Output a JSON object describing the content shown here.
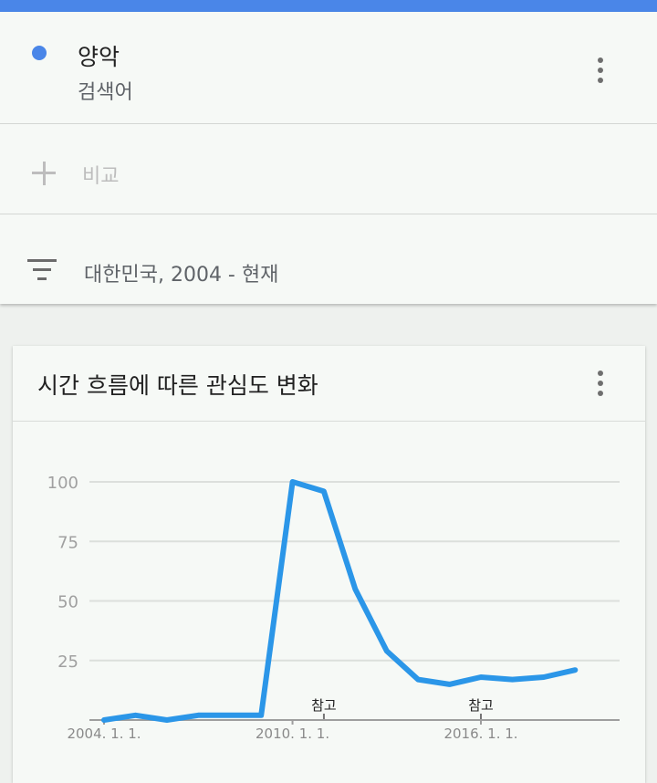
{
  "colors": {
    "accent": "#4a86e8",
    "line": "#2b96e8",
    "text": "#212121",
    "muted": "#5f6368",
    "axis": "#9e9e9e"
  },
  "search": {
    "term": "양악",
    "term_type": "검색어",
    "more_icon": "more-vert-icon"
  },
  "compare": {
    "label": "비교",
    "icon": "add-icon"
  },
  "filter": {
    "label": "대한민국, 2004 - 현재",
    "icon": "filter-list-icon"
  },
  "card": {
    "title": "시간 흐름에 따른 관심도 변화",
    "more_icon": "more-vert-icon"
  },
  "chart_data": {
    "type": "line",
    "title": "시간 흐름에 따른 관심도 변화",
    "xlabel": "",
    "ylabel": "",
    "ylim": [
      0,
      100
    ],
    "xlim": [
      "2004-01-01",
      "2020-06-01"
    ],
    "yticks": [
      "25",
      "50",
      "75",
      "100"
    ],
    "xticks": [
      {
        "date": "2004-01-01",
        "label": "2004. 1. 1."
      },
      {
        "date": "2010-01-01",
        "label": "2010. 1. 1."
      },
      {
        "date": "2016-01-01",
        "label": "2016. 1. 1."
      }
    ],
    "notes": [
      {
        "date": "2011-01-01",
        "label": "참고"
      },
      {
        "date": "2016-01-01",
        "label": "참고"
      }
    ],
    "grid": true,
    "series": [
      {
        "x": [
          "2004-01-01",
          "2005-01-01",
          "2006-01-01",
          "2007-01-01",
          "2008-01-01",
          "2009-01-01",
          "2010-01-01",
          "2011-01-01",
          "2012-01-01",
          "2013-01-01",
          "2014-01-01",
          "2015-01-01",
          "2016-01-01",
          "2017-01-01",
          "2018-01-01",
          "2019-01-01"
        ],
        "values": [
          0,
          2,
          0,
          2,
          2,
          2,
          100,
          96,
          55,
          29,
          17,
          15,
          18,
          17,
          18,
          21
        ]
      }
    ]
  }
}
